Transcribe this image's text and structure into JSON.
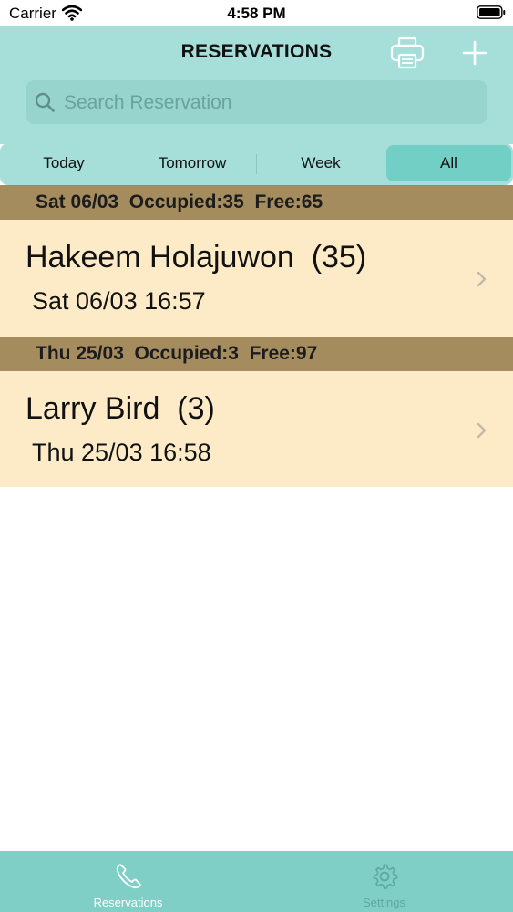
{
  "status": {
    "carrier": "Carrier",
    "time": "4:58 PM"
  },
  "nav": {
    "title": "RESERVATIONS",
    "search_placeholder": "Search Reservation",
    "accent_color": "#a6dfd9"
  },
  "segments": {
    "items": [
      "Today",
      "Tomorrow",
      "Week",
      "All"
    ],
    "selected": "All"
  },
  "sections": [
    {
      "header": "Sat 06/03  Occupied:35  Free:65",
      "rows": [
        {
          "name": "Hakeem Holajuwon  (35)",
          "datetime": "Sat 06/03 16:57"
        }
      ]
    },
    {
      "header": "Thu 25/03  Occupied:3  Free:97",
      "rows": [
        {
          "name": "Larry Bird  (3)",
          "datetime": "Thu 25/03 16:58"
        }
      ]
    }
  ],
  "tabbar": {
    "items": [
      {
        "label": "Reservations",
        "icon": "phone-icon",
        "active": true
      },
      {
        "label": "Settings",
        "icon": "gear-icon",
        "active": false
      }
    ]
  },
  "colors": {
    "header_bg": "#a58c5f",
    "row_bg": "#fdebc8",
    "tabbar_bg": "#7fcfc7",
    "segment_selected": "#72cfc5"
  }
}
